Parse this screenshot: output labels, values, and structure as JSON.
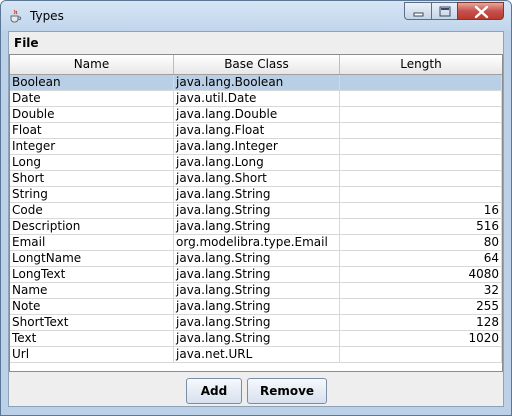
{
  "window": {
    "title": "Types",
    "icon": "java-cup-icon",
    "controls": [
      "minimize-icon",
      "maximize-icon",
      "close-icon"
    ]
  },
  "menubar": {
    "file_label": "File"
  },
  "table": {
    "columns": [
      "Name",
      "Base Class",
      "Length"
    ],
    "selected_row": 0,
    "rows": [
      {
        "name": "Boolean",
        "base_class": "java.lang.Boolean",
        "length": ""
      },
      {
        "name": "Date",
        "base_class": "java.util.Date",
        "length": ""
      },
      {
        "name": "Double",
        "base_class": "java.lang.Double",
        "length": ""
      },
      {
        "name": "Float",
        "base_class": "java.lang.Float",
        "length": ""
      },
      {
        "name": "Integer",
        "base_class": "java.lang.Integer",
        "length": ""
      },
      {
        "name": "Long",
        "base_class": "java.lang.Long",
        "length": ""
      },
      {
        "name": "Short",
        "base_class": "java.lang.Short",
        "length": ""
      },
      {
        "name": "String",
        "base_class": "java.lang.String",
        "length": ""
      },
      {
        "name": "Code",
        "base_class": "java.lang.String",
        "length": "16"
      },
      {
        "name": "Description",
        "base_class": "java.lang.String",
        "length": "516"
      },
      {
        "name": "Email",
        "base_class": "org.modelibra.type.Email",
        "length": "80"
      },
      {
        "name": "LongtName",
        "base_class": "java.lang.String",
        "length": "64"
      },
      {
        "name": "LongText",
        "base_class": "java.lang.String",
        "length": "4080"
      },
      {
        "name": "Name",
        "base_class": "java.lang.String",
        "length": "32"
      },
      {
        "name": "Note",
        "base_class": "java.lang.String",
        "length": "255"
      },
      {
        "name": "ShortText",
        "base_class": "java.lang.String",
        "length": "128"
      },
      {
        "name": "Text",
        "base_class": "java.lang.String",
        "length": "1020"
      },
      {
        "name": "Url",
        "base_class": "java.net.URL",
        "length": ""
      }
    ]
  },
  "buttons": {
    "add_label": "Add",
    "remove_label": "Remove"
  },
  "colors": {
    "selection": "#b8cfe5",
    "close_button": "#c75050",
    "frame": "#bcd1e8"
  }
}
